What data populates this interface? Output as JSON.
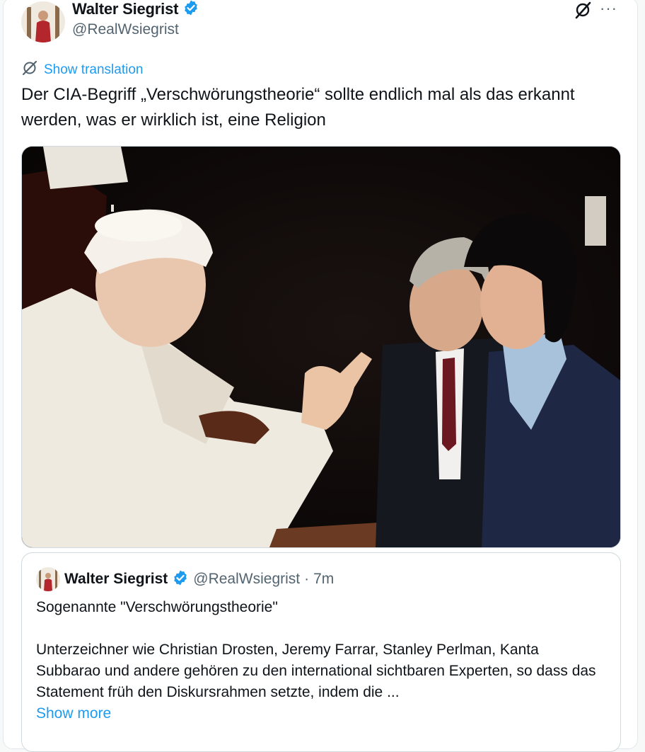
{
  "author": {
    "name": "Walter Siegrist",
    "handle": "@RealWsiegrist",
    "verified": true
  },
  "actions": {
    "grok_icon": "grok-icon",
    "more_label": "···"
  },
  "translation": {
    "label": "Show translation",
    "icon": "translate-icon"
  },
  "tweet": {
    "text": "Der CIA-Begriff „Verschwörungstheorie“ sollte endlich mal als das erkannt werden, was er wirklich ist, eine Religion"
  },
  "quote": {
    "name": "Walter Siegrist",
    "handle": "@RealWsiegrist",
    "separator": "·",
    "time": "7m",
    "title": "Sogenannte \"Verschwörungstheorie\"",
    "body": "Unterzeichner wie Christian Drosten, Jeremy Farrar, Stanley Perlman, Kanta Subbarao und andere gehören zu den international sichtbaren Experten, so dass das Statement früh den Diskursrahmen setzte, indem die ...",
    "show_more": "Show more"
  },
  "colors": {
    "accent": "#1d9bf0",
    "text": "#0f1419",
    "secondary": "#536471",
    "border": "#cfd9de"
  }
}
